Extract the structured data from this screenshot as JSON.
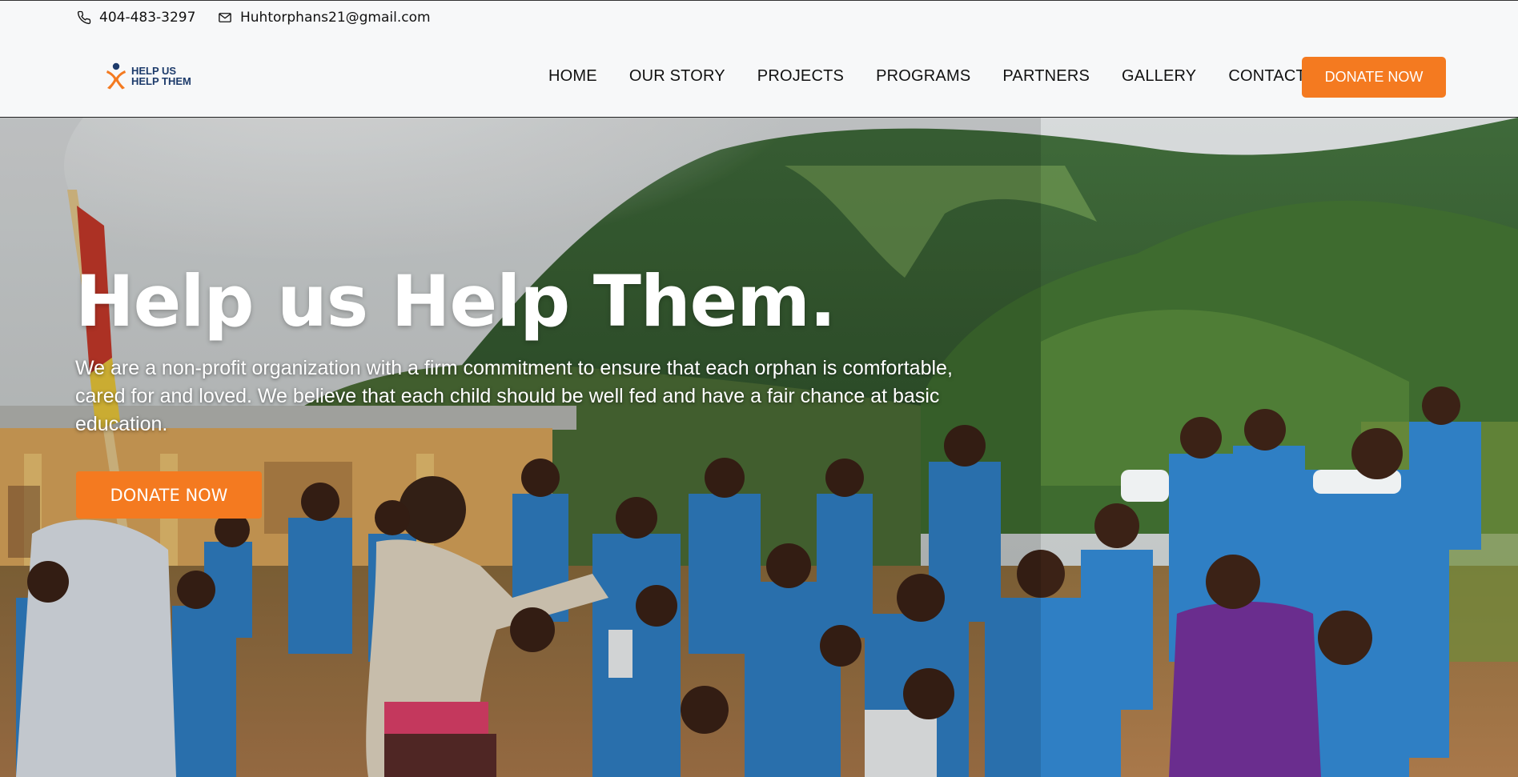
{
  "topbar": {
    "phone": "404-483-3297",
    "email": "Huhtorphans21@gmail.com",
    "phone_icon": "phone-icon",
    "email_icon": "mail-icon"
  },
  "logo": {
    "line1": "HELP US",
    "line2": "HELP THEM",
    "icon": "person-x-logo-icon"
  },
  "nav": {
    "items": [
      {
        "label": "HOME"
      },
      {
        "label": "OUR STORY"
      },
      {
        "label": "PROJECTS"
      },
      {
        "label": "PROGRAMS"
      },
      {
        "label": "PARTNERS"
      },
      {
        "label": "GALLERY"
      },
      {
        "label": "CONTACT"
      }
    ],
    "donate_label": "DONATE NOW"
  },
  "hero": {
    "title": "Help us Help Them.",
    "text": "We are a non-profit organization with a firm commitment to ensure that each orphan is comfortable, cared for and loved. We believe that each child should be well fed and have a fair chance at basic education.",
    "donate_label": "DONATE NOW"
  },
  "colors": {
    "accent": "#f47a20",
    "brand_navy": "#1d3b6b",
    "uniform_blue": "#2f7fc4"
  }
}
